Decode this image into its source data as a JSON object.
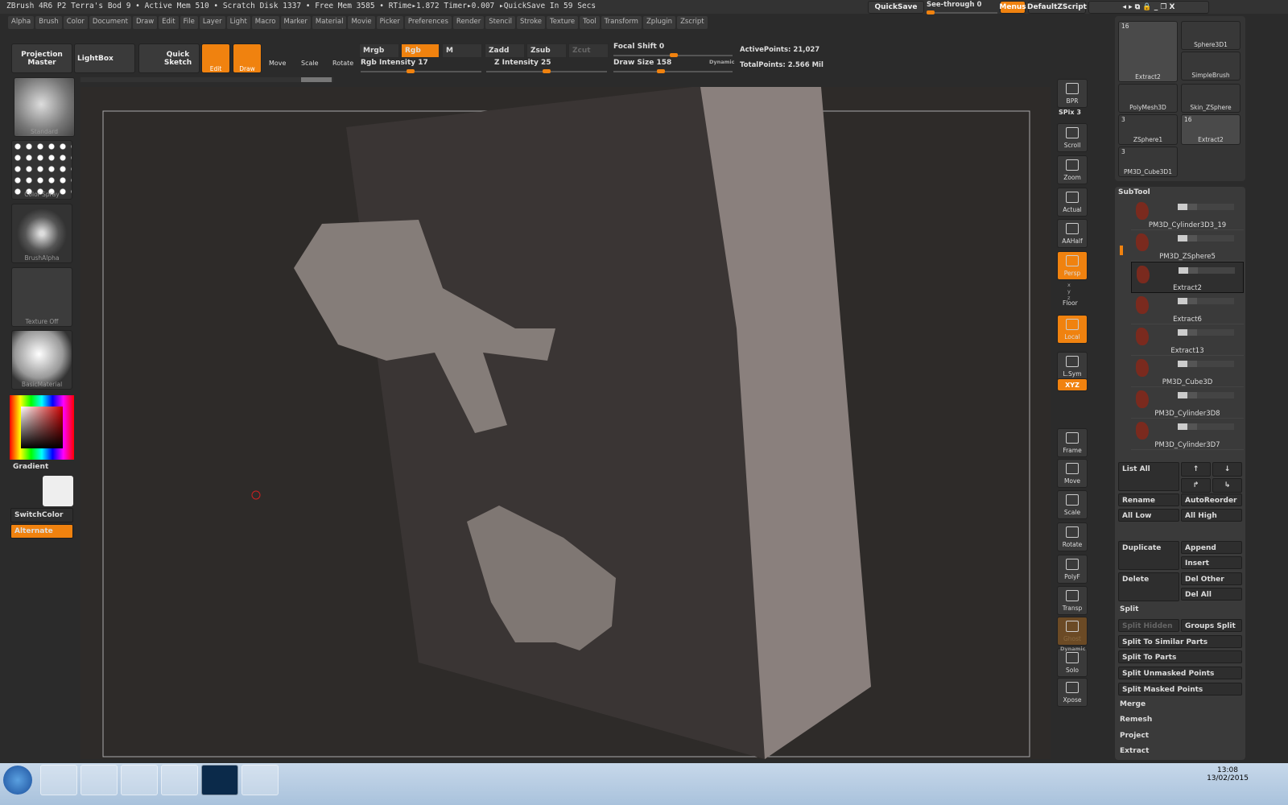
{
  "titlebar": {
    "text": "ZBrush 4R6 P2   Terra's Bod 9   • Active Mem 510 • Scratch Disk 1337 • Free Mem 3585 • RTime▸1.872 Timer▸0.007 ▸QuickSave In 59 Secs"
  },
  "menus": [
    "Alpha",
    "Brush",
    "Color",
    "Document",
    "Draw",
    "Edit",
    "File",
    "Layer",
    "Light",
    "Macro",
    "Marker",
    "Material",
    "Movie",
    "Picker",
    "Preferences",
    "Render",
    "Stencil",
    "Stroke",
    "Texture",
    "Tool",
    "Transform",
    "Zplugin",
    "Zscript"
  ],
  "topright": {
    "quicksave": "QuickSave",
    "seethrough": "See-through  0",
    "menus": "Menus",
    "script": "DefaultZScript"
  },
  "toolbar": {
    "projection_master": "Projection Master",
    "lightbox": "LightBox",
    "quick_sketch": "Quick Sketch",
    "edit": "Edit",
    "draw": "Draw",
    "move": "Move",
    "scale": "Scale",
    "rotate": "Rotate",
    "mrgb": "Mrgb",
    "rgb": "Rgb",
    "m": "M",
    "zadd": "Zadd",
    "zsub": "Zsub",
    "zcut": "Zcut",
    "rgb_intensity": "Rgb Intensity 17",
    "z_intensity": "Z Intensity 25",
    "focal_shift": "Focal Shift 0",
    "draw_size": "Draw Size 158",
    "dynamic": "Dynamic",
    "active_points": "ActivePoints: 21,027",
    "total_points": "TotalPoints: 2.566 Mil"
  },
  "sliders": {
    "rgb_intensity": 17,
    "z_intensity": 25,
    "focal_shift": 0,
    "draw_size": 158,
    "see_through": 0
  },
  "left": {
    "brush": "Standard",
    "stroke": "Color Spray",
    "alpha": "BrushAlpha",
    "texture": "Texture Off",
    "material": "BasicMaterial",
    "gradient": "Gradient",
    "switchcolor": "SwitchColor",
    "alternate": "Alternate"
  },
  "shelf": [
    {
      "label": "BPR"
    },
    {
      "label": "SPix 3"
    },
    {
      "label": "Scroll"
    },
    {
      "label": "Zoom"
    },
    {
      "label": "Actual"
    },
    {
      "label": "AAHalf"
    },
    {
      "label": "Persp"
    },
    {
      "label": "Floor"
    },
    {
      "label": "Local"
    },
    {
      "label": "L.Sym"
    },
    {
      "label": "XYZ"
    },
    {
      "label": "Frame"
    },
    {
      "label": "Move"
    },
    {
      "label": "Scale"
    },
    {
      "label": "Rotate"
    },
    {
      "label": "PolyF"
    },
    {
      "label": "Transp"
    },
    {
      "label": "Ghost"
    },
    {
      "label": "Solo"
    },
    {
      "label": "Xpose"
    }
  ],
  "shelf_extra": {
    "xyz": "x y z",
    "dynamic": "Dynamic"
  },
  "tools": [
    {
      "name": "Extract2",
      "count": "16"
    },
    {
      "name": "Sphere3D1"
    },
    {
      "name": "SimpleBrush"
    },
    {
      "name": "PolyMesh3D"
    },
    {
      "name": "Skin_ZSphere"
    },
    {
      "name": "ZSphere1",
      "count": "3"
    },
    {
      "name": "Extract2",
      "count": "16"
    },
    {
      "name": "PM3D_Cube3D1",
      "count": "3"
    }
  ],
  "subtool": {
    "title": "SubTool",
    "items": [
      "PM3D_Cylinder3D3_19",
      "PM3D_ZSphere5",
      "Extract2",
      "Extract6",
      "Extract13",
      "PM3D_Cube3D",
      "PM3D_Cylinder3D8",
      "PM3D_Cylinder3D7"
    ],
    "selected": 2
  },
  "panel": {
    "list_all": "List All",
    "rename": "Rename",
    "autoreorder": "AutoReorder",
    "all_low": "All Low",
    "all_high": "All High",
    "duplicate": "Duplicate",
    "append": "Append",
    "insert": "Insert",
    "delete": "Delete",
    "del_other": "Del Other",
    "del_all": "Del All",
    "split": "Split",
    "split_hidden": "Split Hidden",
    "groups_split": "Groups Split",
    "split_similar": "Split To Similar Parts",
    "split_parts": "Split To Parts",
    "split_unmasked": "Split Unmasked Points",
    "split_masked": "Split Masked Points",
    "merge": "Merge",
    "remesh": "Remesh",
    "project": "Project",
    "extract": "Extract"
  },
  "taskbar": {
    "time": "13:08",
    "date": "13/02/2015"
  }
}
